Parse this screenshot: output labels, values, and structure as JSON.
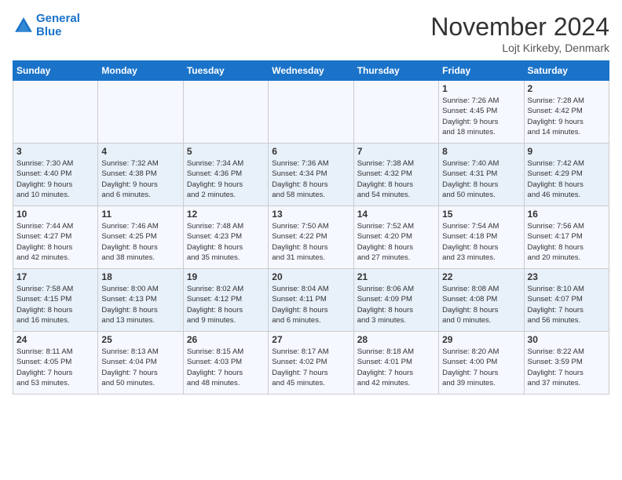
{
  "logo": {
    "line1": "General",
    "line2": "Blue"
  },
  "title": "November 2024",
  "location": "Lojt Kirkeby, Denmark",
  "weekdays": [
    "Sunday",
    "Monday",
    "Tuesday",
    "Wednesday",
    "Thursday",
    "Friday",
    "Saturday"
  ],
  "weeks": [
    [
      {
        "day": "",
        "info": ""
      },
      {
        "day": "",
        "info": ""
      },
      {
        "day": "",
        "info": ""
      },
      {
        "day": "",
        "info": ""
      },
      {
        "day": "",
        "info": ""
      },
      {
        "day": "1",
        "info": "Sunrise: 7:26 AM\nSunset: 4:45 PM\nDaylight: 9 hours\nand 18 minutes."
      },
      {
        "day": "2",
        "info": "Sunrise: 7:28 AM\nSunset: 4:42 PM\nDaylight: 9 hours\nand 14 minutes."
      }
    ],
    [
      {
        "day": "3",
        "info": "Sunrise: 7:30 AM\nSunset: 4:40 PM\nDaylight: 9 hours\nand 10 minutes."
      },
      {
        "day": "4",
        "info": "Sunrise: 7:32 AM\nSunset: 4:38 PM\nDaylight: 9 hours\nand 6 minutes."
      },
      {
        "day": "5",
        "info": "Sunrise: 7:34 AM\nSunset: 4:36 PM\nDaylight: 9 hours\nand 2 minutes."
      },
      {
        "day": "6",
        "info": "Sunrise: 7:36 AM\nSunset: 4:34 PM\nDaylight: 8 hours\nand 58 minutes."
      },
      {
        "day": "7",
        "info": "Sunrise: 7:38 AM\nSunset: 4:32 PM\nDaylight: 8 hours\nand 54 minutes."
      },
      {
        "day": "8",
        "info": "Sunrise: 7:40 AM\nSunset: 4:31 PM\nDaylight: 8 hours\nand 50 minutes."
      },
      {
        "day": "9",
        "info": "Sunrise: 7:42 AM\nSunset: 4:29 PM\nDaylight: 8 hours\nand 46 minutes."
      }
    ],
    [
      {
        "day": "10",
        "info": "Sunrise: 7:44 AM\nSunset: 4:27 PM\nDaylight: 8 hours\nand 42 minutes."
      },
      {
        "day": "11",
        "info": "Sunrise: 7:46 AM\nSunset: 4:25 PM\nDaylight: 8 hours\nand 38 minutes."
      },
      {
        "day": "12",
        "info": "Sunrise: 7:48 AM\nSunset: 4:23 PM\nDaylight: 8 hours\nand 35 minutes."
      },
      {
        "day": "13",
        "info": "Sunrise: 7:50 AM\nSunset: 4:22 PM\nDaylight: 8 hours\nand 31 minutes."
      },
      {
        "day": "14",
        "info": "Sunrise: 7:52 AM\nSunset: 4:20 PM\nDaylight: 8 hours\nand 27 minutes."
      },
      {
        "day": "15",
        "info": "Sunrise: 7:54 AM\nSunset: 4:18 PM\nDaylight: 8 hours\nand 23 minutes."
      },
      {
        "day": "16",
        "info": "Sunrise: 7:56 AM\nSunset: 4:17 PM\nDaylight: 8 hours\nand 20 minutes."
      }
    ],
    [
      {
        "day": "17",
        "info": "Sunrise: 7:58 AM\nSunset: 4:15 PM\nDaylight: 8 hours\nand 16 minutes."
      },
      {
        "day": "18",
        "info": "Sunrise: 8:00 AM\nSunset: 4:13 PM\nDaylight: 8 hours\nand 13 minutes."
      },
      {
        "day": "19",
        "info": "Sunrise: 8:02 AM\nSunset: 4:12 PM\nDaylight: 8 hours\nand 9 minutes."
      },
      {
        "day": "20",
        "info": "Sunrise: 8:04 AM\nSunset: 4:11 PM\nDaylight: 8 hours\nand 6 minutes."
      },
      {
        "day": "21",
        "info": "Sunrise: 8:06 AM\nSunset: 4:09 PM\nDaylight: 8 hours\nand 3 minutes."
      },
      {
        "day": "22",
        "info": "Sunrise: 8:08 AM\nSunset: 4:08 PM\nDaylight: 8 hours\nand 0 minutes."
      },
      {
        "day": "23",
        "info": "Sunrise: 8:10 AM\nSunset: 4:07 PM\nDaylight: 7 hours\nand 56 minutes."
      }
    ],
    [
      {
        "day": "24",
        "info": "Sunrise: 8:11 AM\nSunset: 4:05 PM\nDaylight: 7 hours\nand 53 minutes."
      },
      {
        "day": "25",
        "info": "Sunrise: 8:13 AM\nSunset: 4:04 PM\nDaylight: 7 hours\nand 50 minutes."
      },
      {
        "day": "26",
        "info": "Sunrise: 8:15 AM\nSunset: 4:03 PM\nDaylight: 7 hours\nand 48 minutes."
      },
      {
        "day": "27",
        "info": "Sunrise: 8:17 AM\nSunset: 4:02 PM\nDaylight: 7 hours\nand 45 minutes."
      },
      {
        "day": "28",
        "info": "Sunrise: 8:18 AM\nSunset: 4:01 PM\nDaylight: 7 hours\nand 42 minutes."
      },
      {
        "day": "29",
        "info": "Sunrise: 8:20 AM\nSunset: 4:00 PM\nDaylight: 7 hours\nand 39 minutes."
      },
      {
        "day": "30",
        "info": "Sunrise: 8:22 AM\nSunset: 3:59 PM\nDaylight: 7 hours\nand 37 minutes."
      }
    ]
  ]
}
